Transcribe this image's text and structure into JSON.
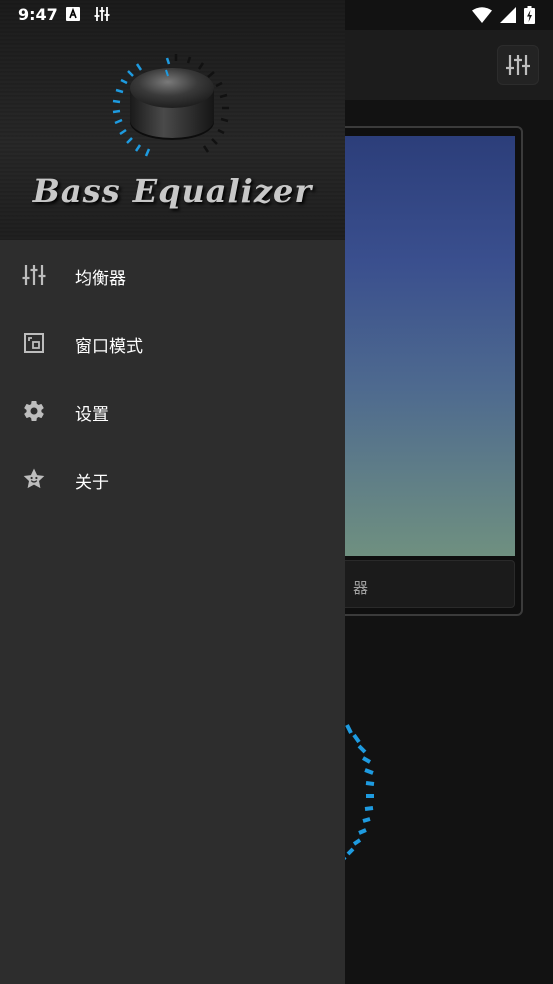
{
  "status_bar": {
    "time": "9:47",
    "left_icons": [
      "a-badge-icon",
      "equalizer-status-icon"
    ],
    "right_icons": [
      "wifi-icon",
      "signal-icon",
      "battery-charging-icon"
    ]
  },
  "drawer": {
    "header": {
      "logo_text": "Bass Equalizer"
    },
    "menu": [
      {
        "label": "均衡器",
        "icon": "equalizer-icon"
      },
      {
        "label": "窗口模式",
        "icon": "window-mode-icon"
      },
      {
        "label": "设置",
        "icon": "gear-icon"
      },
      {
        "label": "关于",
        "icon": "star-face-icon"
      }
    ]
  },
  "background_app": {
    "card_label_partial": "器"
  },
  "colors": {
    "accent": "#1e9be0",
    "drawer_bg": "#2d2d2d",
    "app_bg": "#121212"
  }
}
